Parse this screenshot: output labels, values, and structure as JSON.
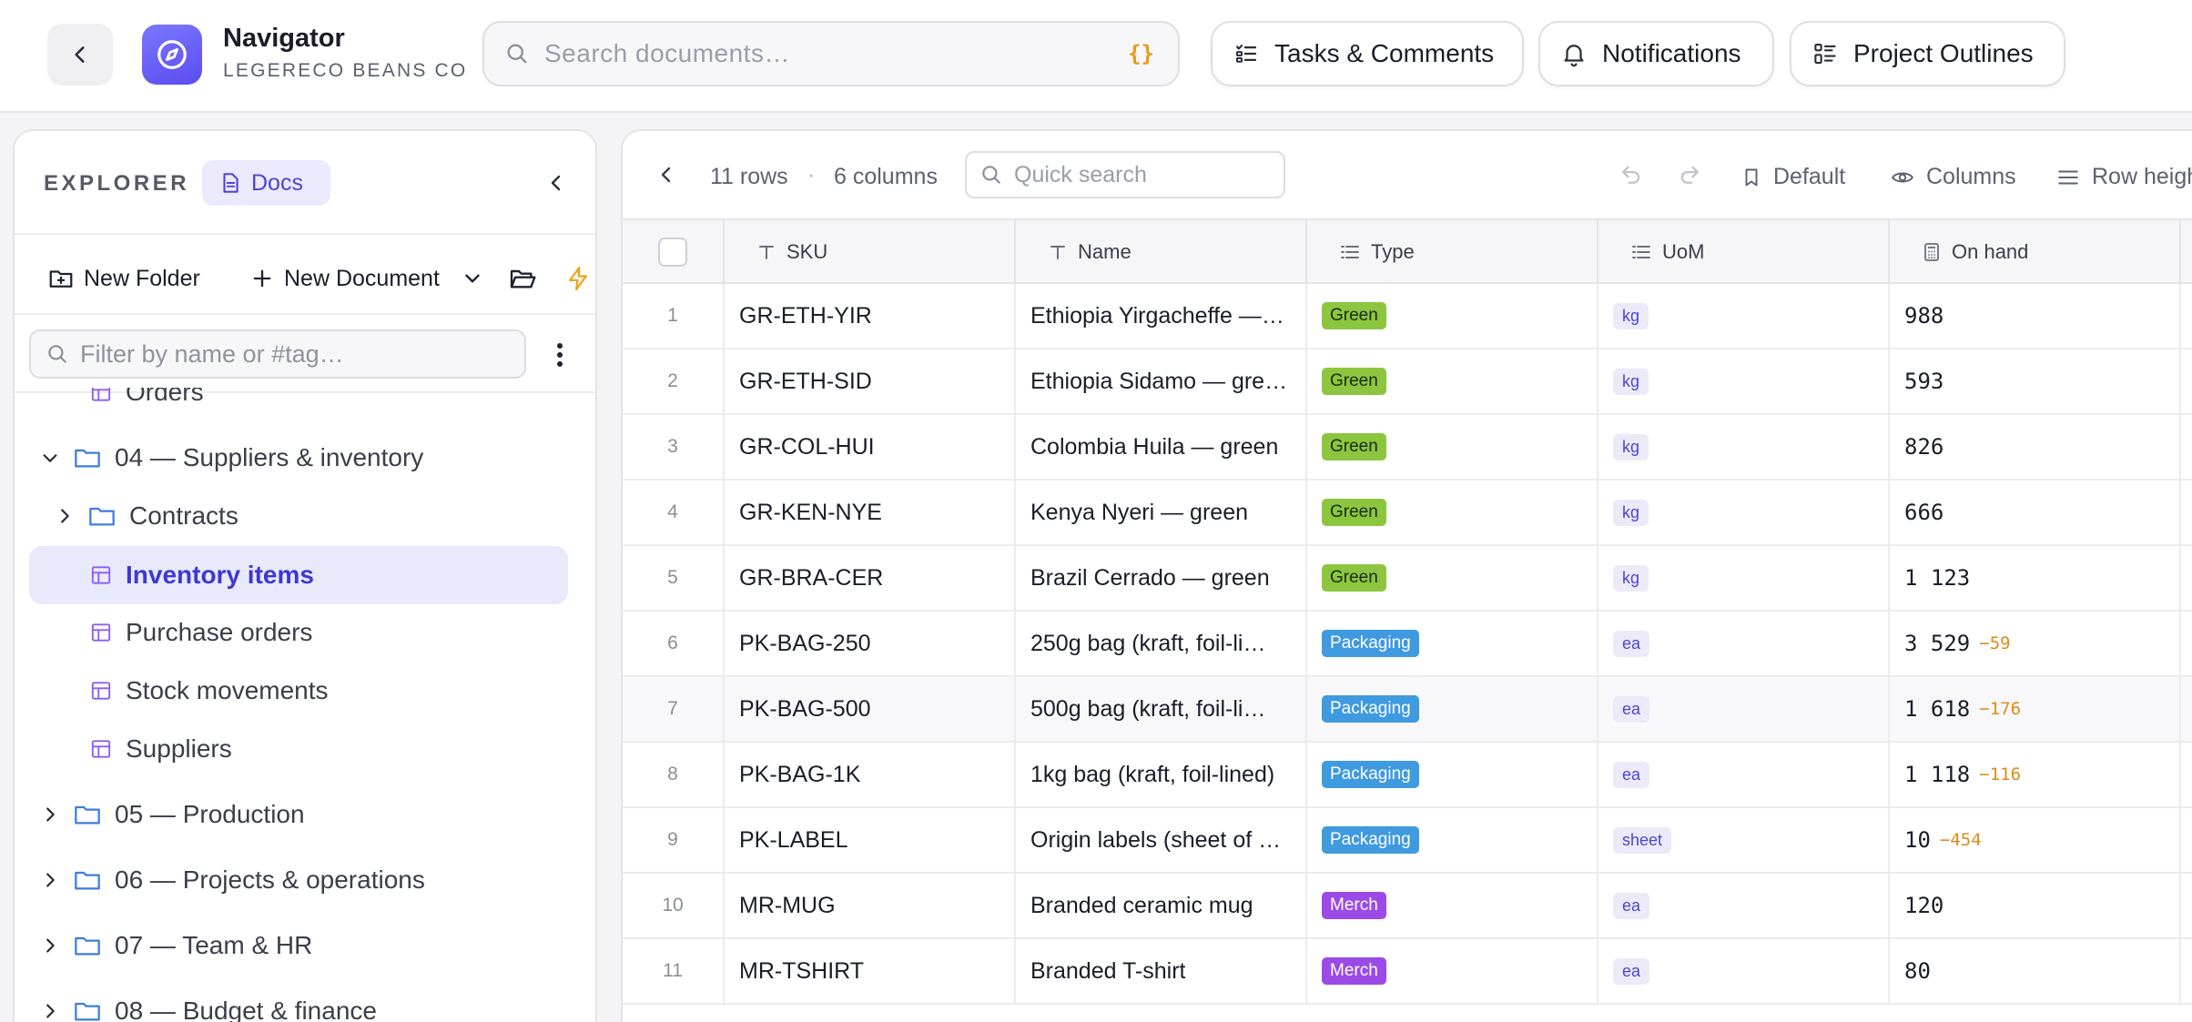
{
  "app": {
    "title": "Navigator",
    "subtitle": "LEGERECO BEANS CO"
  },
  "search": {
    "placeholder": "Search documents…",
    "hint": "{}"
  },
  "header_buttons": {
    "tasks": "Tasks & Comments",
    "notifications": "Notifications",
    "outlines": "Project Outlines"
  },
  "sidebar": {
    "label": "EXPLORER",
    "chip": "Docs",
    "actions": {
      "new_folder": "New Folder",
      "new_document": "New Document"
    },
    "filter_placeholder": "Filter by name or #tag…",
    "tree": [
      {
        "label": "Orders",
        "kind": "table",
        "depth": 1
      },
      {
        "label": "04 — Suppliers & inventory",
        "kind": "folder",
        "expanded": true,
        "depth": 0
      },
      {
        "label": "Contracts",
        "kind": "folder",
        "expanded": false,
        "depth": 1
      },
      {
        "label": "Inventory items",
        "kind": "table",
        "active": true,
        "depth": 1
      },
      {
        "label": "Purchase orders",
        "kind": "table",
        "depth": 1
      },
      {
        "label": "Stock movements",
        "kind": "table",
        "depth": 1
      },
      {
        "label": "Suppliers",
        "kind": "table",
        "depth": 1
      },
      {
        "label": "05 — Production",
        "kind": "folder",
        "expanded": false,
        "depth": 0
      },
      {
        "label": "06 — Projects & operations",
        "kind": "folder",
        "expanded": false,
        "depth": 0
      },
      {
        "label": "07 — Team & HR",
        "kind": "folder",
        "expanded": false,
        "depth": 0
      },
      {
        "label": "08 — Budget & finance",
        "kind": "folder",
        "expanded": false,
        "depth": 0
      }
    ]
  },
  "grid": {
    "row_count": "11 rows",
    "col_count": "6 columns",
    "quick_search_placeholder": "Quick search",
    "view_default": "Default",
    "columns_btn": "Columns",
    "row_height_btn": "Row height",
    "headers": {
      "sku": "SKU",
      "name": "Name",
      "type": "Type",
      "uom": "UoM",
      "on_hand": "On hand"
    },
    "type_colors": {
      "Green": "#8cc63f",
      "Packaging": "#3f9ae0",
      "Merch": "#9b4ae8"
    },
    "rows": [
      {
        "idx": "1",
        "sku": "GR-ETH-YIR",
        "name": "Ethiopia Yirgacheffe —…",
        "type": "Green",
        "uom": "kg",
        "on_hand": "988",
        "delta": ""
      },
      {
        "idx": "2",
        "sku": "GR-ETH-SID",
        "name": "Ethiopia Sidamo — gre…",
        "type": "Green",
        "uom": "kg",
        "on_hand": "593",
        "delta": ""
      },
      {
        "idx": "3",
        "sku": "GR-COL-HUI",
        "name": "Colombia Huila — green",
        "type": "Green",
        "uom": "kg",
        "on_hand": "826",
        "delta": ""
      },
      {
        "idx": "4",
        "sku": "GR-KEN-NYE",
        "name": "Kenya Nyeri — green",
        "type": "Green",
        "uom": "kg",
        "on_hand": "666",
        "delta": ""
      },
      {
        "idx": "5",
        "sku": "GR-BRA-CER",
        "name": "Brazil Cerrado — green",
        "type": "Green",
        "uom": "kg",
        "on_hand": "1 123",
        "delta": ""
      },
      {
        "idx": "6",
        "sku": "PK-BAG-250",
        "name": "250g bag (kraft, foil-li…",
        "type": "Packaging",
        "uom": "ea",
        "on_hand": "3 529",
        "delta": "−59"
      },
      {
        "idx": "7",
        "sku": "PK-BAG-500",
        "name": "500g bag (kraft, foil-li…",
        "type": "Packaging",
        "uom": "ea",
        "on_hand": "1 618",
        "delta": "−176"
      },
      {
        "idx": "8",
        "sku": "PK-BAG-1K",
        "name": "1kg bag (kraft, foil-lined)",
        "type": "Packaging",
        "uom": "ea",
        "on_hand": "1 118",
        "delta": "−116"
      },
      {
        "idx": "9",
        "sku": "PK-LABEL",
        "name": "Origin labels (sheet of …",
        "type": "Packaging",
        "uom": "sheet",
        "on_hand": "10",
        "delta": "−454"
      },
      {
        "idx": "10",
        "sku": "MR-MUG",
        "name": "Branded ceramic mug",
        "type": "Merch",
        "uom": "ea",
        "on_hand": "120",
        "delta": ""
      },
      {
        "idx": "11",
        "sku": "MR-TSHIRT",
        "name": "Branded T-shirt",
        "type": "Merch",
        "uom": "ea",
        "on_hand": "80",
        "delta": ""
      }
    ]
  }
}
